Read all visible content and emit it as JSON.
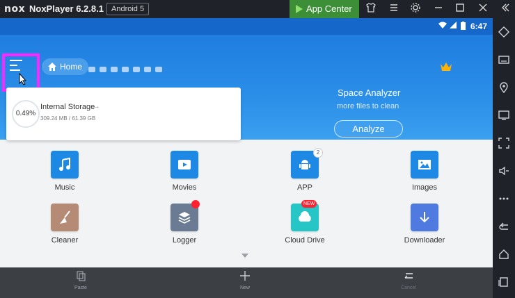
{
  "window": {
    "logo_text": "nox",
    "title": "NoxPlayer 6.2.8.1",
    "android_version": "Android 5",
    "app_center_label": "App Center",
    "accent_green": "#3c8f36",
    "title_icons": [
      "shirt-icon",
      "menu-icon",
      "gear-icon",
      "minimize-icon",
      "maximize-icon",
      "close-icon",
      "collapse-icon"
    ]
  },
  "status_bar": {
    "time": "6:47",
    "icons": [
      "wifi-icon",
      "signal-icon",
      "battery-icon"
    ]
  },
  "header": {
    "home_label": "Home",
    "highlight_color": "#ff26ff"
  },
  "storage": {
    "percent": "0.49%",
    "name": "Internal Storage",
    "size": "309.24 MB / 61.39 GB"
  },
  "analyzer": {
    "title": "Space Analyzer",
    "subtitle": "more files to clean",
    "button": "Analyze"
  },
  "apps": [
    {
      "label": "Music",
      "color": "#1e88e5"
    },
    {
      "label": "Movies",
      "color": "#1e88e5"
    },
    {
      "label": "APP",
      "color": "#1e88e5",
      "badge": "2"
    },
    {
      "label": "Images",
      "color": "#1e88e5"
    },
    {
      "label": "Cleaner",
      "color": "#b58b76"
    },
    {
      "label": "Logger",
      "color": "#6b7b93"
    },
    {
      "label": "Cloud Drive",
      "color": "#26c6c6",
      "badge": "NEW"
    },
    {
      "label": "Downloader",
      "color": "#4f7be0"
    }
  ],
  "bottom_bar": {
    "paste": "Paste",
    "new": "New",
    "cancel": "Cancel"
  }
}
